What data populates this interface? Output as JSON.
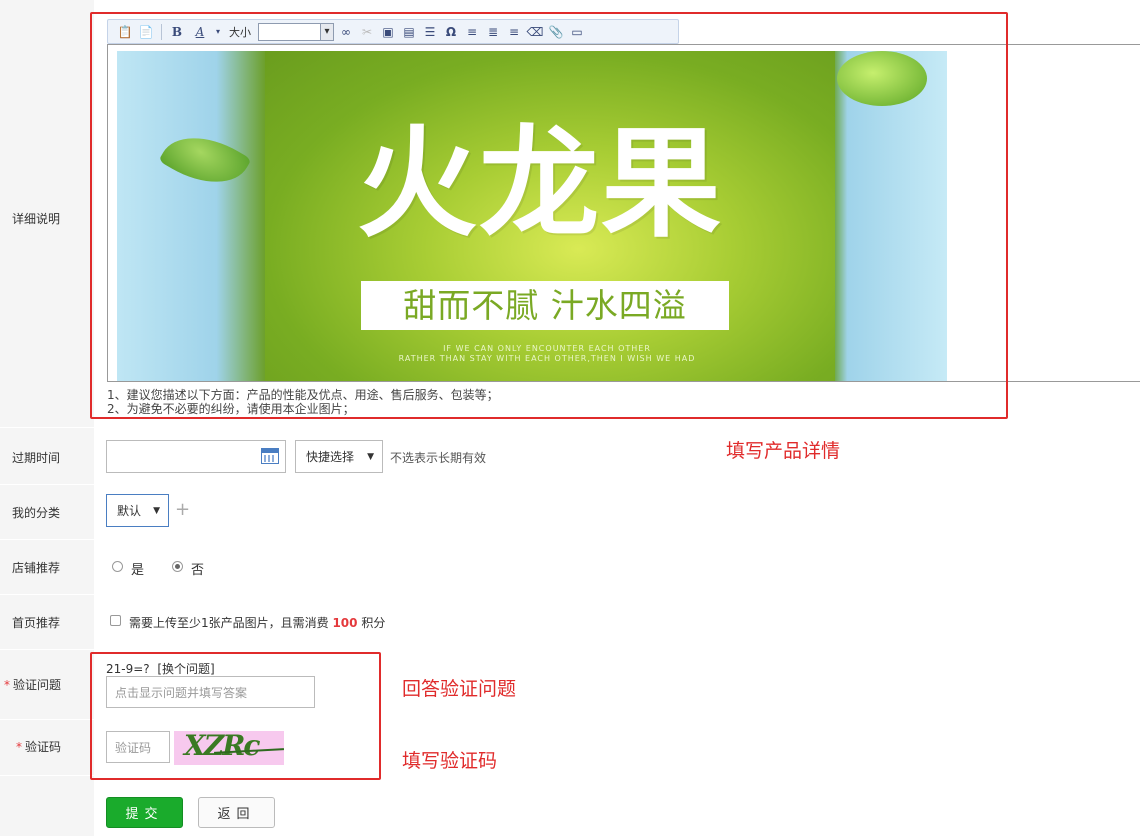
{
  "labels": {
    "detail": "详细说明",
    "expire": "过期时间",
    "category": "我的分类",
    "shop_recommend": "店铺推荐",
    "home_recommend": "首页推荐",
    "verify_question": "验证问题",
    "verify_code": "验证码",
    "required_mark": "*"
  },
  "editor": {
    "toolbar": {
      "bold": "B",
      "font_color": "A",
      "size_label": "大小",
      "omega": "Ω"
    },
    "banner": {
      "title": "火龙果",
      "slogan": "甜而不腻 汁水四溢",
      "english_line1": "IF WE CAN ONLY ENCOUNTER EACH OTHER",
      "english_line2": "RATHER THAN STAY WITH EACH OTHER,THEN I WISH WE HAD"
    },
    "tips": {
      "line1": "1、建议您描述以下方面：产品的性能及优点、用途、售后服务、包装等；",
      "line2": "2、为避免不必要的纠纷，请使用本企业图片；"
    }
  },
  "expire": {
    "quick_select": "快捷选择",
    "hint": "不选表示长期有效"
  },
  "category": {
    "selected": "默认",
    "add": "+"
  },
  "shop_recommend": {
    "yes": "是",
    "no": "否",
    "selected": "no"
  },
  "home_recommend": {
    "text_before": "需要上传至少1张产品图片，且需消费 ",
    "points": "100",
    "text_after": " 积分"
  },
  "verify_question": {
    "question": "21-9=?",
    "change": "[换个问题]",
    "placeholder": "点击显示问题并填写答案"
  },
  "verify_code": {
    "placeholder": "验证码",
    "captcha_text": "XZRc"
  },
  "buttons": {
    "submit": "提交",
    "back": "返回"
  },
  "annotations": {
    "detail": "填写产品详情",
    "question": "回答验证问题",
    "code": "填写验证码"
  },
  "colors": {
    "annotation": "#e02b2b",
    "submit_green": "#1aab2c",
    "points_red": "#e4393c"
  }
}
